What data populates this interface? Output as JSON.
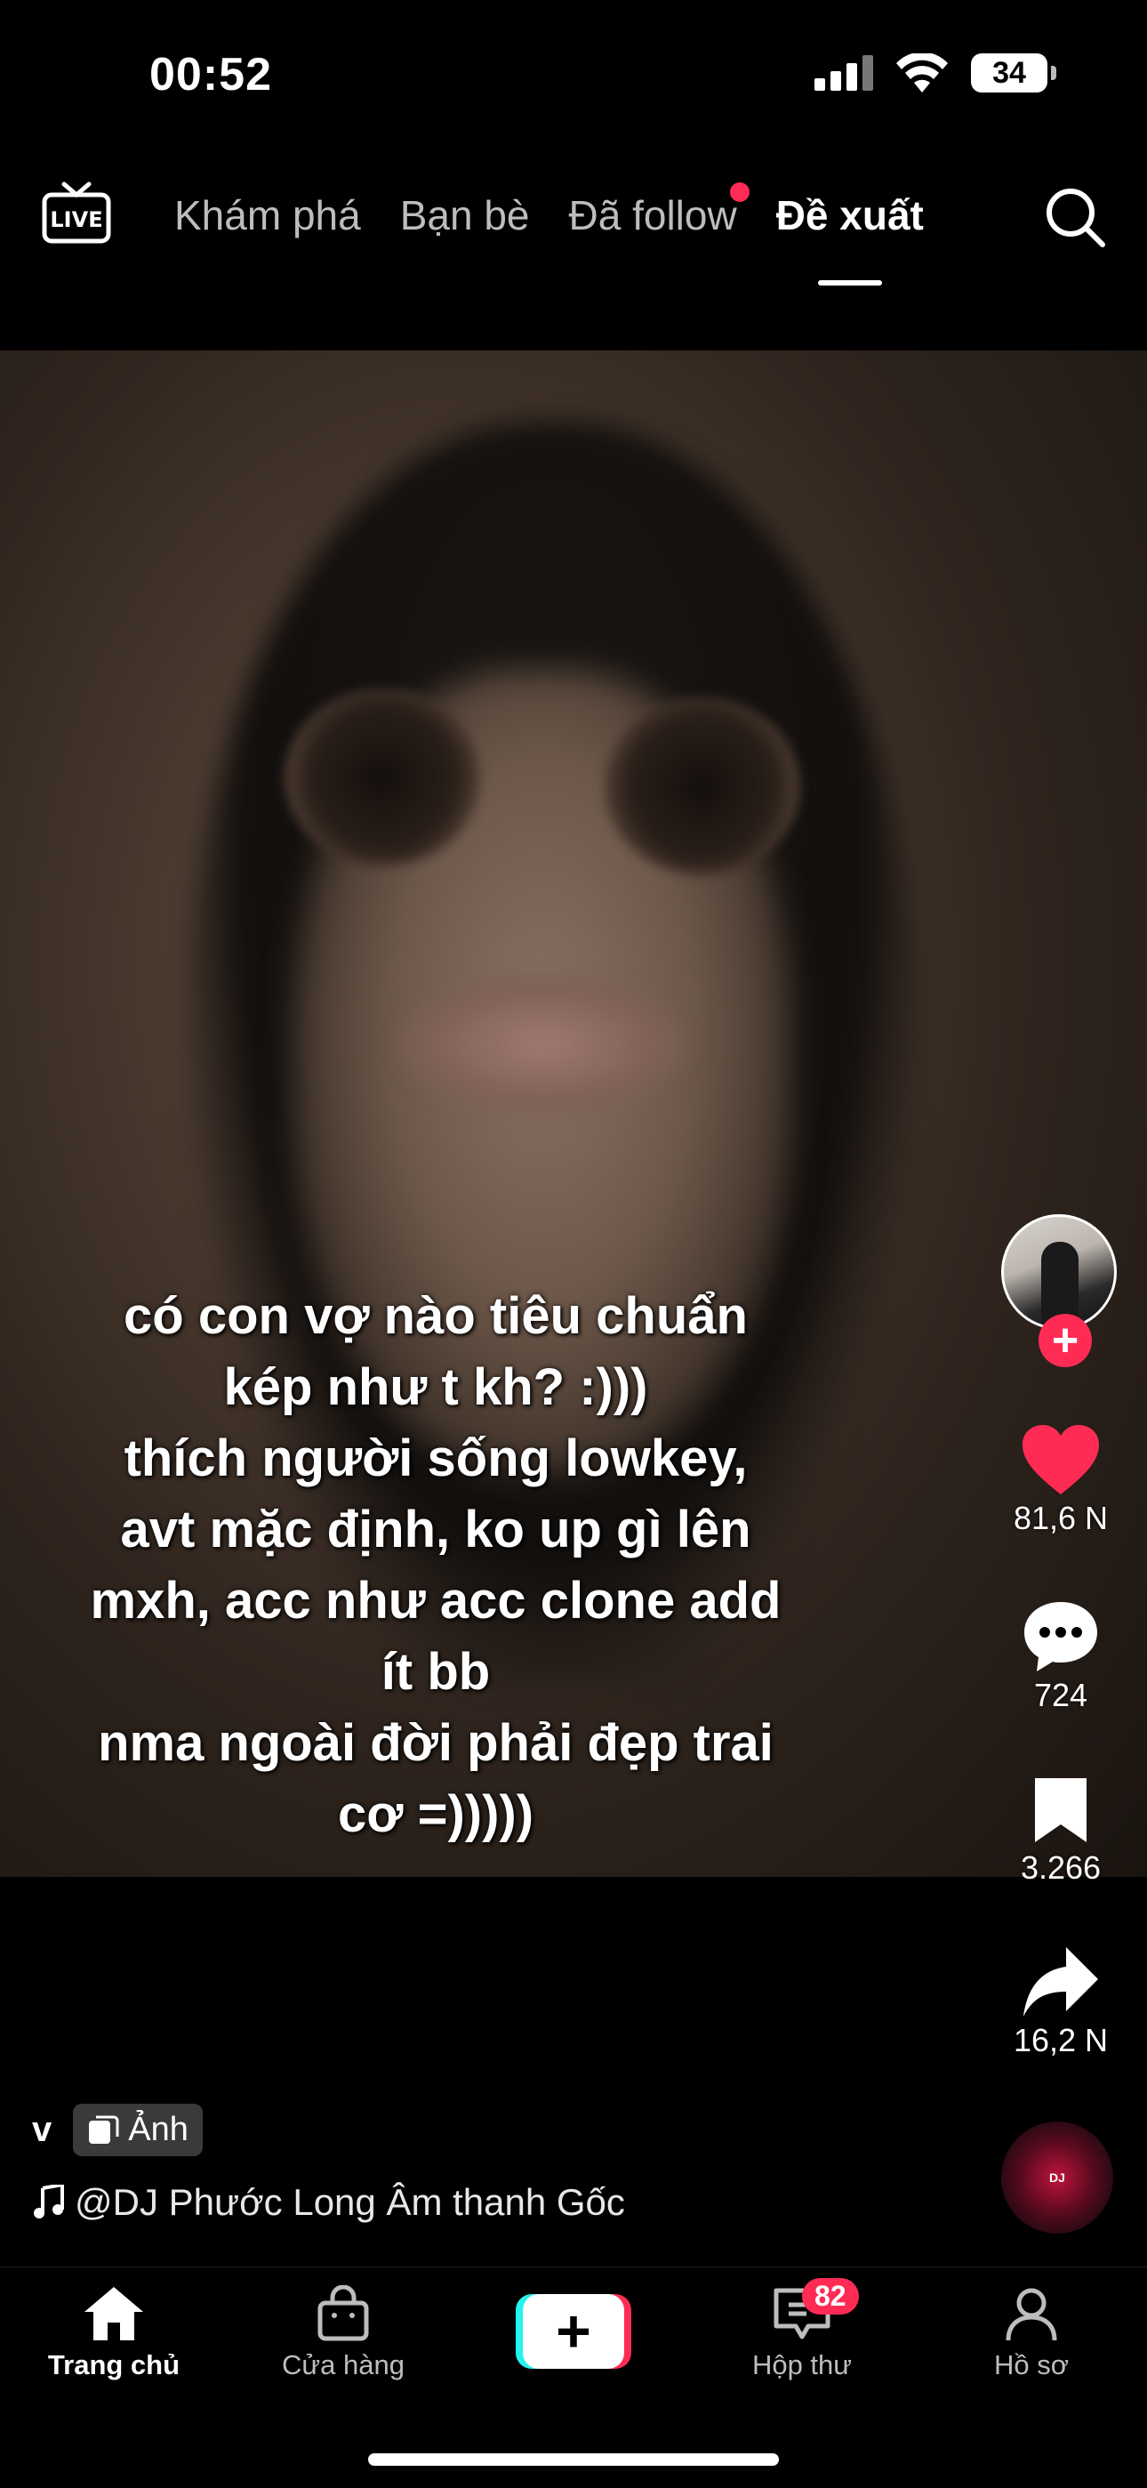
{
  "status": {
    "time": "00:52",
    "battery": "34"
  },
  "topnav": {
    "tabs": [
      {
        "label": "Khám phá"
      },
      {
        "label": "Bạn bè"
      },
      {
        "label": "Đã follow"
      },
      {
        "label": "Đề xuất"
      }
    ],
    "active_tab": "Đề xuất",
    "live_icon": "live-tv-icon"
  },
  "post": {
    "caption": "có con vợ nào tiêu chuẩn\nkép như t kh? :)))\nthích người sống lowkey,\navt mặc định, ko up gì lên\nmxh, acc như acc clone add\nít bb\nnma ngoài đời phải đẹp trai\ncơ =)))))",
    "author": "v",
    "type_badge": "Ảnh",
    "sound": "@DJ Phước Long Âm thanh Gốc",
    "likes": "81,6 N",
    "comments": "724",
    "saves": "3.266",
    "shares": "16,2 N"
  },
  "bottombar": {
    "items": [
      {
        "label": "Trang chủ"
      },
      {
        "label": "Cửa hàng"
      },
      {
        "label": "Hộp thư",
        "badge": "82"
      },
      {
        "label": "Hồ sơ"
      }
    ]
  },
  "colors": {
    "accent": "#fe2c55",
    "cyan": "#25f4ee"
  }
}
